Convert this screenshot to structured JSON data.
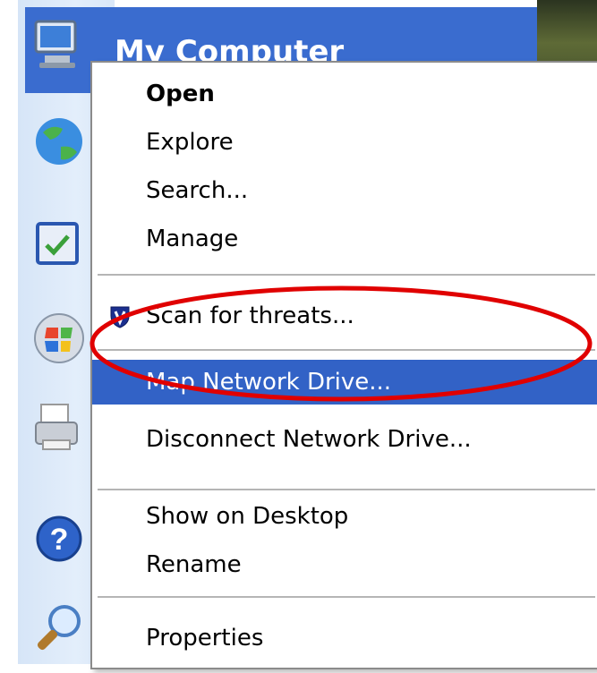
{
  "start_menu": {
    "my_computer_label": "My Computer",
    "icons": [
      "my-computer-icon",
      "internet-icon",
      "control-panel-icon",
      "windows-update-icon",
      "printers-icon",
      "help-icon",
      "search-icon"
    ]
  },
  "context_menu": {
    "items": [
      {
        "label": "Open",
        "bold": true
      },
      {
        "label": "Explore"
      },
      {
        "label": "Search..."
      },
      {
        "label": "Manage"
      },
      {
        "label": "Scan for threats...",
        "icon": "shield-icon"
      },
      {
        "label": "Map Network Drive...",
        "selected": true
      },
      {
        "label": "Disconnect Network Drive..."
      },
      {
        "label": "Show on Desktop"
      },
      {
        "label": "Rename"
      },
      {
        "label": "Properties"
      }
    ],
    "selected_color": "#3262c6",
    "annotation_color": "#e00000"
  }
}
